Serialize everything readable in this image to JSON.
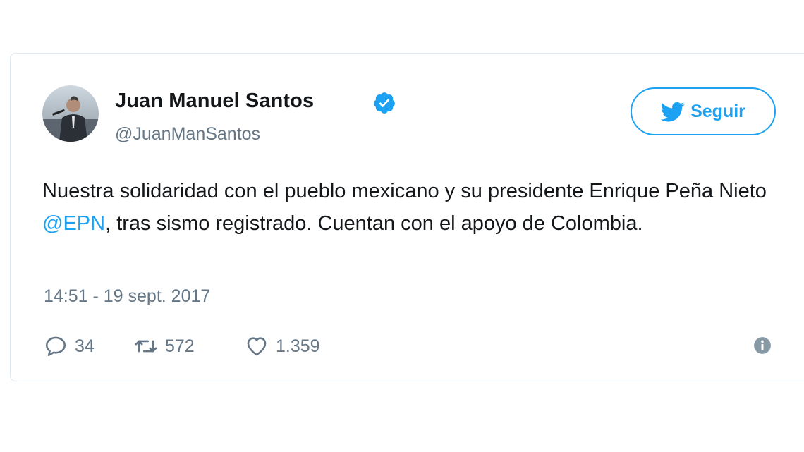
{
  "author": {
    "display_name": "Juan Manuel Santos",
    "handle": "@JuanManSantos",
    "verified_icon": "verified-badge-icon",
    "avatar_icon": "avatar-photo"
  },
  "follow_button": {
    "label": "Seguir",
    "icon": "twitter-bird-icon"
  },
  "tweet": {
    "text_part1": "Nuestra solidaridad con el pueblo mexicano y su presidente Enrique Peña Nieto ",
    "mention": "@EPN",
    "text_part2": ", tras sismo registrado. Cuentan con el apoyo de Colombia.",
    "timestamp": "14:51 - 19 sept. 2017"
  },
  "actions": {
    "reply_count": "34",
    "retweet_count": "572",
    "like_count": "1.359"
  },
  "colors": {
    "accent": "#1da1f2",
    "text": "#14171a",
    "secondary_text": "#657786",
    "border": "#e1e8ed"
  }
}
